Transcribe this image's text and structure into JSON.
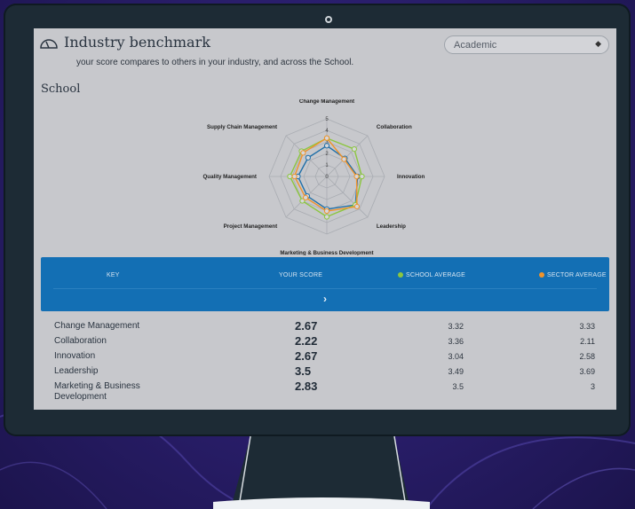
{
  "header": {
    "icon": "gauge-icon",
    "title": "Industry benchmark",
    "subtitle": "your score compares to others in your industry, and across the School."
  },
  "filter": {
    "selected": "Academic"
  },
  "section_title": "School",
  "chart_data": {
    "type": "radar",
    "axes": [
      "Change Management",
      "Collaboration",
      "Innovation",
      "Leadership",
      "Marketing & Business Development",
      "Project Management",
      "Quality Management",
      "Supply Chain Management"
    ],
    "rlim": [
      0,
      5
    ],
    "ticks": [
      "0",
      "1",
      "2",
      "3",
      "4",
      "5"
    ],
    "series": [
      {
        "name": "YOUR SCORE",
        "color": "#1f6fa8",
        "values": [
          2.67,
          2.22,
          2.67,
          3.5,
          2.83,
          2.4,
          2.5,
          2.3
        ]
      },
      {
        "name": "SCHOOL AVERAGE",
        "color": "#8cc63f",
        "values": [
          3.32,
          3.36,
          3.04,
          3.49,
          3.5,
          3.0,
          3.2,
          3.1
        ]
      },
      {
        "name": "SECTOR AVERAGE",
        "color": "#f0932b",
        "values": [
          3.33,
          2.11,
          2.58,
          3.69,
          3.0,
          2.6,
          2.8,
          2.9
        ]
      }
    ]
  },
  "key": {
    "key_label": "KEY",
    "your_score": "YOUR SCORE",
    "school_avg": "SCHOOL AVERAGE",
    "sector_avg": "SECTOR AVERAGE",
    "school_color": "#8cc63f",
    "sector_color": "#f0932b"
  },
  "rows": [
    {
      "label": "Change Management",
      "yours": "2.67",
      "school": "3.32",
      "sector": "3.33"
    },
    {
      "label": "Collaboration",
      "yours": "2.22",
      "school": "3.36",
      "sector": "2.11"
    },
    {
      "label": "Innovation",
      "yours": "2.67",
      "school": "3.04",
      "sector": "2.58"
    },
    {
      "label": "Leadership",
      "yours": "3.5",
      "school": "3.49",
      "sector": "3.69"
    },
    {
      "label": "Marketing & Business Development",
      "yours": "2.83",
      "school": "3.5",
      "sector": "3"
    }
  ]
}
